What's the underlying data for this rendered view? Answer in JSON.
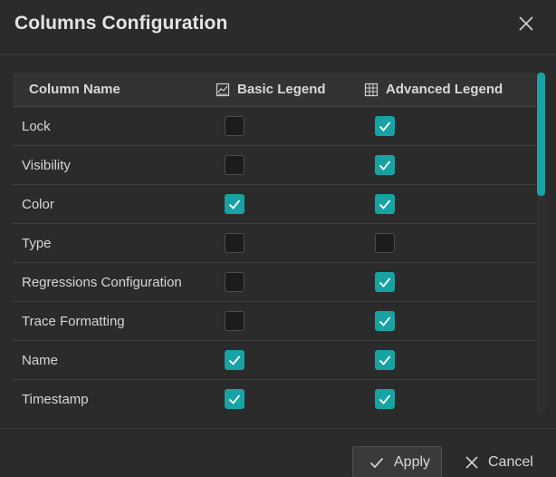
{
  "dialog": {
    "title": "Columns Configuration"
  },
  "table": {
    "headers": {
      "column_name": "Column Name",
      "basic_legend": "Basic Legend",
      "advanced_legend": "Advanced Legend"
    },
    "rows": [
      {
        "name": "Lock",
        "basic": false,
        "advanced": true
      },
      {
        "name": "Visibility",
        "basic": false,
        "advanced": true
      },
      {
        "name": "Color",
        "basic": true,
        "advanced": true
      },
      {
        "name": "Type",
        "basic": false,
        "advanced": false
      },
      {
        "name": "Regressions Configuration",
        "basic": false,
        "advanced": true
      },
      {
        "name": "Trace Formatting",
        "basic": false,
        "advanced": true
      },
      {
        "name": "Name",
        "basic": true,
        "advanced": true
      },
      {
        "name": "Timestamp",
        "basic": true,
        "advanced": true
      }
    ]
  },
  "footer": {
    "apply_label": "Apply",
    "cancel_label": "Cancel"
  },
  "icons": {
    "close": "close-icon",
    "basic_legend": "legend-icon",
    "advanced_legend": "table-legend-icon",
    "check": "check-icon",
    "apply": "check-icon",
    "cancel": "close-icon"
  },
  "colors": {
    "accent": "#17a3a3",
    "background": "#2b2b2b",
    "header_row": "#333333",
    "unchecked": "#1c1c1c"
  }
}
